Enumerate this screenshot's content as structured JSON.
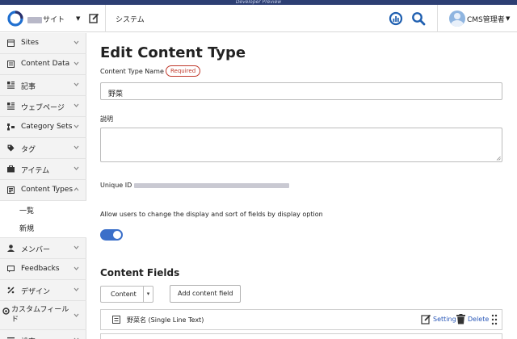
{
  "preview_bar": {
    "text": "Developer Preview"
  },
  "header": {
    "site_name": "サイト",
    "system_link": "システム",
    "user_name": "CMS管理者"
  },
  "sidebar": {
    "items": [
      {
        "label": "Sites",
        "icon": "sites-icon"
      },
      {
        "label": "Content Data",
        "icon": "content-data-icon"
      },
      {
        "label": "記事",
        "icon": "entries-icon"
      },
      {
        "label": "ウェブページ",
        "icon": "pages-icon"
      },
      {
        "label": "Category Sets",
        "icon": "category-sets-icon"
      },
      {
        "label": "タグ",
        "icon": "tag-icon"
      },
      {
        "label": "アイテム",
        "icon": "assets-icon"
      },
      {
        "label": "Content Types",
        "icon": "content-types-icon"
      }
    ],
    "sub_items": [
      {
        "label": "一覧"
      },
      {
        "label": "新規"
      }
    ],
    "items_after": [
      {
        "label": "メンバー",
        "icon": "user-icon"
      },
      {
        "label": "Feedbacks",
        "icon": "feedbacks-icon"
      },
      {
        "label": "デザイン",
        "icon": "design-icon"
      },
      {
        "label": "カスタムフィールド",
        "icon": "custom-fields-icon"
      },
      {
        "label": "設定",
        "icon": "settings-icon"
      }
    ]
  },
  "main": {
    "title": "Edit Content Type",
    "name_label": "Content Type Name",
    "required_badge": "Required",
    "name_value": "野菜",
    "description_label": "説明",
    "description_value": "",
    "unique_id_label": "Unique ID",
    "display_option_label": "Allow users to change the display and sort of fields by display option",
    "display_option_enabled": true,
    "fields_section_title": "Content Fields",
    "field_type_select": "Content",
    "add_field_button": "Add content field",
    "fields": [
      {
        "name": "野菜名 (Single Line Text)",
        "setting_label": "Setting",
        "delete_label": "Delete"
      }
    ]
  },
  "colors": {
    "accent": "#3b6fc9",
    "link": "#2a58b8",
    "required": "#c0392b",
    "preview_bar": "#2d3f73"
  }
}
